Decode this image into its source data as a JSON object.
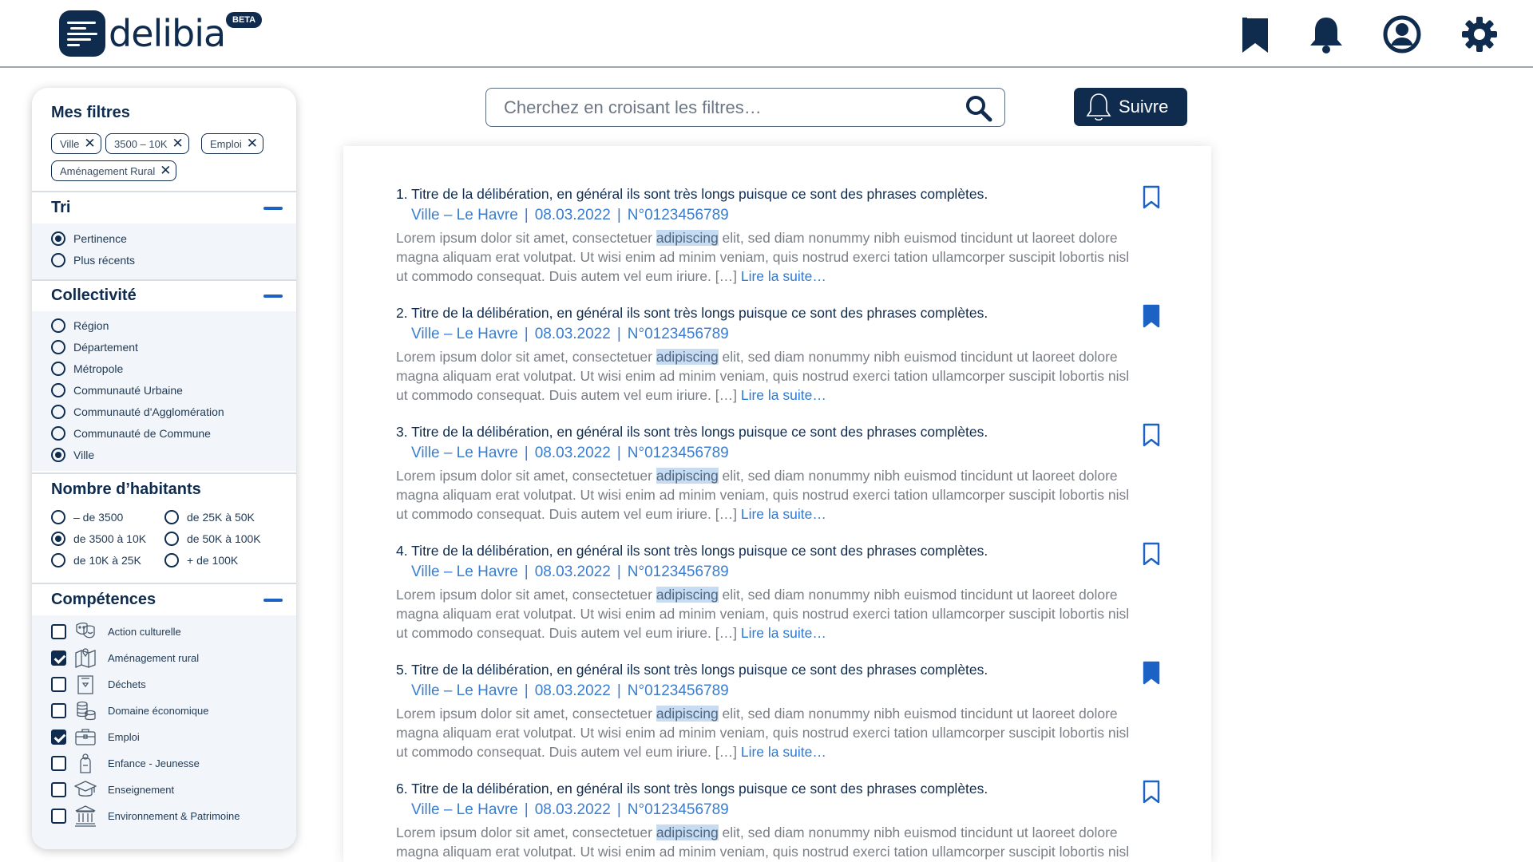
{
  "brand": {
    "logo_text": "delibia",
    "badge": "BETA"
  },
  "colors": {
    "navy": "#0f2c4f",
    "accent_blue": "#1b62c4",
    "link_blue": "#3a7dd0",
    "highlight": "#c7dbf3"
  },
  "header": {
    "icons": [
      "bookmark-icon",
      "bell-icon",
      "user-icon",
      "gear-icon"
    ]
  },
  "sidebar": {
    "filters_title": "Mes filtres",
    "chips": [
      "Ville",
      "3500 – 10K",
      "Emploi",
      "Aménagement Rural"
    ],
    "sort": {
      "title": "Tri",
      "options": [
        "Pertinence",
        "Plus récents"
      ],
      "selected": "Pertinence"
    },
    "collectivite": {
      "title": "Collectivité",
      "options": [
        "Région",
        "Département",
        "Métropole",
        "Communauté Urbaine",
        "Communauté d'Agglomération",
        "Communauté de Commune",
        "Ville"
      ],
      "selected": "Ville"
    },
    "habitants": {
      "title": "Nombre d’habitants",
      "options": [
        "– de 3500",
        "de 3500 à 10K",
        "de 10K à 25K",
        "de 25K à 50K",
        "de 50K à 100K",
        "+ de 100K"
      ],
      "selected": "de 3500 à 10K"
    },
    "competences": {
      "title": "Compétences",
      "items": [
        {
          "label": "Action culturelle",
          "checked": false,
          "icon": "theater-icon"
        },
        {
          "label": "Aménagement rural",
          "checked": true,
          "icon": "map-icon"
        },
        {
          "label": "Déchets",
          "checked": false,
          "icon": "trash-icon"
        },
        {
          "label": "Domaine économique",
          "checked": false,
          "icon": "coins-icon"
        },
        {
          "label": "Emploi",
          "checked": true,
          "icon": "briefcase-icon"
        },
        {
          "label": "Enfance - Jeunesse",
          "checked": false,
          "icon": "child-icon"
        },
        {
          "label": "Enseignement",
          "checked": false,
          "icon": "graduation-cap-icon"
        },
        {
          "label": "Environnement & Patrimoine",
          "checked": false,
          "icon": "monument-icon"
        }
      ]
    }
  },
  "search": {
    "placeholder": "Cherchez en croisant les filtres…",
    "follow_label": "Suivre"
  },
  "results": [
    {
      "title": "1. Titre de la délibération, en général ils sont très longs puisque ce sont des phrases complètes.",
      "place": "Ville – Le Havre",
      "date": "08.03.2022",
      "number": "N°0123456789",
      "bookmarked": false
    },
    {
      "title": "2. Titre de la délibération, en général ils sont très longs puisque ce sont des phrases complètes.",
      "place": "Ville – Le Havre",
      "date": "08.03.2022",
      "number": "N°0123456789",
      "bookmarked": true
    },
    {
      "title": "3. Titre de la délibération, en général ils sont très longs puisque ce sont des phrases complètes.",
      "place": "Ville – Le Havre",
      "date": "08.03.2022",
      "number": "N°0123456789",
      "bookmarked": false
    },
    {
      "title": "4. Titre de la délibération, en général ils sont très longs puisque ce sont des phrases complètes.",
      "place": "Ville – Le Havre",
      "date": "08.03.2022",
      "number": "N°0123456789",
      "bookmarked": false
    },
    {
      "title": "5. Titre de la délibération, en général ils sont très longs puisque ce sont des phrases complètes.",
      "place": "Ville – Le Havre",
      "date": "08.03.2022",
      "number": "N°0123456789",
      "bookmarked": true
    },
    {
      "title": "6. Titre de la délibération, en général ils sont très longs puisque ce sont des phrases complètes.",
      "place": "Ville – Le Havre",
      "date": "08.03.2022",
      "number": "N°0123456789",
      "bookmarked": false
    }
  ],
  "snippet": {
    "before": "Lorem ipsum dolor sit amet, consectetuer ",
    "highlight": "adipiscing",
    "after": " elit, sed diam nonummy nibh euismod tincidunt ut laoreet dolore magna aliquam erat volutpat. Ut wisi enim ad minim veniam, quis nostrud exerci tation ullamcorper suscipit lobortis nisl ut commodo consequat. Duis autem vel eum iriure. […] ",
    "more": "Lire la suite…"
  }
}
